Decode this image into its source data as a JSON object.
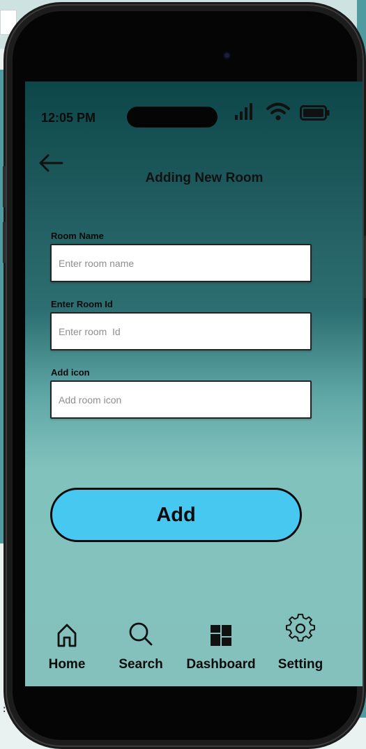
{
  "status_bar": {
    "time": "12:05 PM"
  },
  "header": {
    "back_icon": "arrow-left-icon",
    "title": "Adding New Room"
  },
  "form": {
    "room_name": {
      "label": "Room Name",
      "placeholder": "Enter room name",
      "value": ""
    },
    "room_id": {
      "label": "Enter Room Id",
      "placeholder": "Enter room  Id",
      "value": ""
    },
    "room_icon": {
      "label": "Add icon",
      "placeholder": "Add room icon",
      "value": ""
    },
    "submit_label": "Add"
  },
  "bottom_nav": {
    "items": [
      {
        "label": "Home",
        "icon": "home-icon"
      },
      {
        "label": "Search",
        "icon": "search-icon"
      },
      {
        "label": "Dashboard",
        "icon": "dashboard-icon"
      },
      {
        "label": "Setting",
        "icon": "gear-icon"
      }
    ]
  },
  "background": {
    "code_snippet": ":/>"
  },
  "colors": {
    "screen_top": "#0c4649",
    "screen_bottom": "#84c1bd",
    "add_button": "#46c8f1",
    "phone_frame": "#1c1c1c"
  }
}
